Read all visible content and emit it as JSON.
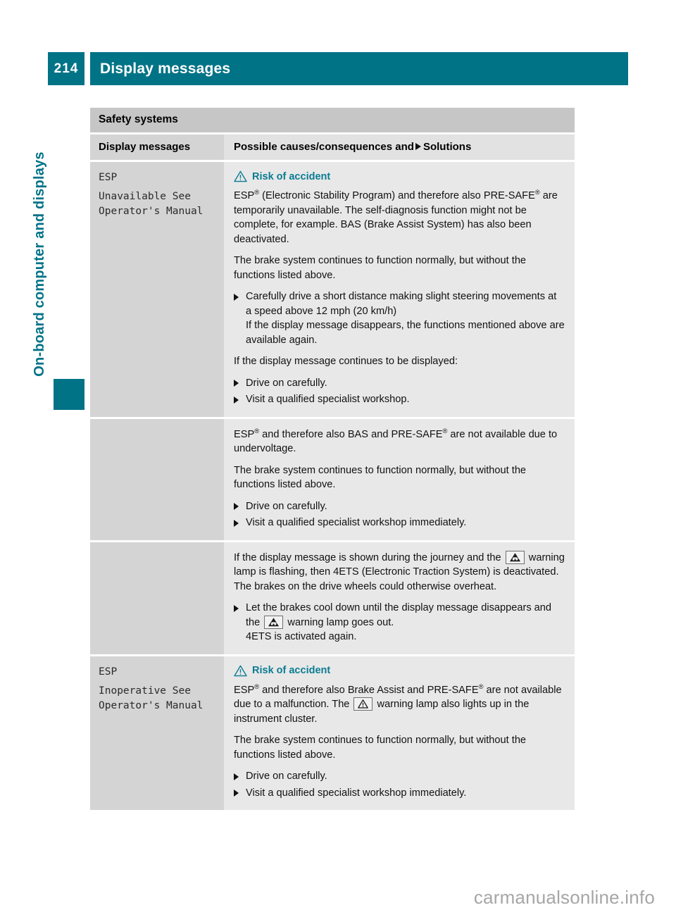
{
  "header": {
    "page_number": "214",
    "title": "Display messages"
  },
  "side": {
    "chapter_title": "On-board computer and displays"
  },
  "table": {
    "section_title": "Safety systems",
    "columns": {
      "left": "Display messages",
      "right_prefix": "Possible causes/consequences and",
      "right_suffix": "Solutions"
    },
    "rows": [
      {
        "message_line1": "ESP",
        "message_line2": "Unavailable See",
        "message_line3": "Operator's Manual",
        "warning_label": "Risk of accident",
        "p1_a": "ESP",
        "p1_b": " (Electronic Stability Program) and therefore also PRE-SAFE",
        "p1_c": " are temporarily unavailable. The self-diagnosis function might not be complete, for example. BAS (Brake Assist System) has also been deactivated.",
        "p2": "The brake system continues to function normally, but without the functions listed above.",
        "step1_main": "Carefully drive a short distance making slight steering movements at a speed above 12 mph (20 km/h)",
        "step1_sub": "If the display message disappears, the functions mentioned above are available again.",
        "p3": "If the display message continues to be displayed:",
        "step2": "Drive on carefully.",
        "step3": "Visit a qualified specialist workshop."
      },
      {
        "p1_a": "ESP",
        "p1_b": " and therefore also BAS and PRE-SAFE",
        "p1_c": " are not available due to undervoltage.",
        "p2": "The brake system continues to function normally, but without the functions listed above.",
        "step1": "Drive on carefully.",
        "step2": "Visit a qualified specialist workshop immediately."
      },
      {
        "p1_a": "If the display message is shown during the journey and the",
        "p1_b": "warning lamp is flashing, then 4ETS (Electronic Traction System) is deactivated. The brakes on the drive wheels could otherwise overheat.",
        "step1_a": "Let the brakes cool down until the display message disappears and the",
        "step1_b": "warning lamp goes out.",
        "step1_sub": "4ETS is activated again."
      },
      {
        "message_line1": "ESP",
        "message_line2": "Inoperative See",
        "message_line3": "Operator's Manual",
        "warning_label": "Risk of accident",
        "p1_a": "ESP",
        "p1_b": " and therefore also Brake Assist and PRE-SAFE",
        "p1_c": " are not available due to a malfunction. The",
        "p1_d": "warning lamp also lights up in the instrument cluster.",
        "p2": "The brake system continues to function normally, but without the functions listed above.",
        "step1": "Drive on carefully.",
        "step2": "Visit a qualified specialist workshop immediately."
      }
    ]
  },
  "footer": {
    "watermark": "carmanualsonline.info"
  },
  "colors": {
    "teal": "#017387",
    "warning_teal": "#0b7c92",
    "section_gray": "#c6c6c6",
    "left_col_gray": "#d4d4d4",
    "right_col_gray": "#e8e8e8"
  },
  "icons": {
    "warning_triangle": "warning-triangle-icon",
    "esp_lamp": "esp-warning-lamp-icon",
    "traction_lamp": "4ets-traction-warning-lamp-icon",
    "solution_bullet": "solution-triangle-bullet"
  }
}
